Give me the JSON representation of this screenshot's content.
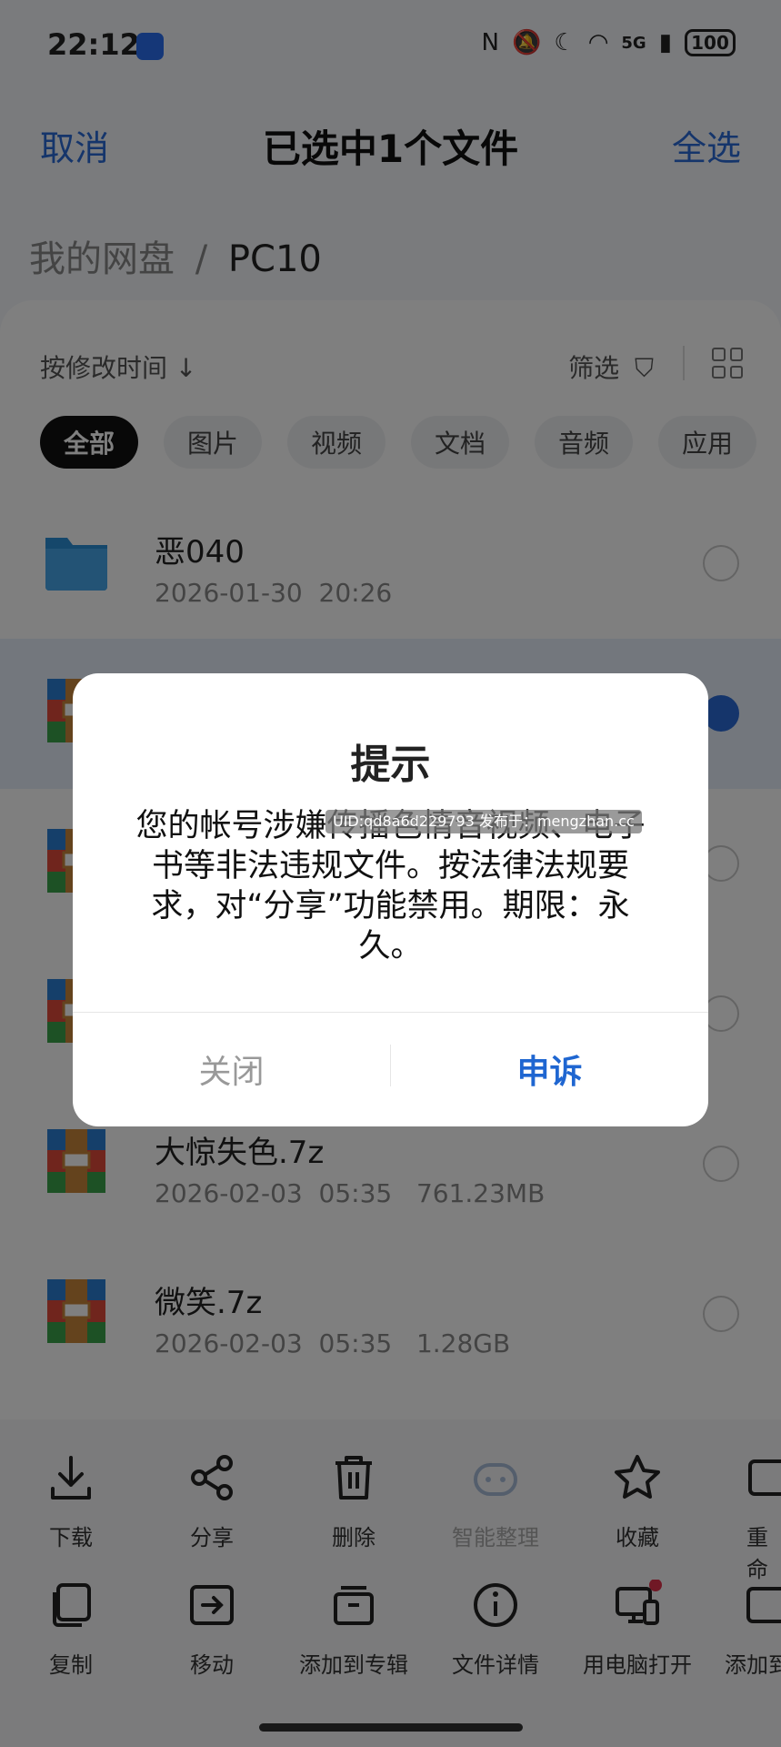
{
  "status_bar": {
    "time": "22:12",
    "network": "5G",
    "battery": "100"
  },
  "header": {
    "cancel": "取消",
    "title": "已选中1个文件",
    "select_all": "全选"
  },
  "breadcrumb": {
    "root": "我的网盘",
    "separator": "/",
    "current": "PC10"
  },
  "toolbar": {
    "sort": "按修改时间",
    "filter": "筛选"
  },
  "chips": [
    "全部",
    "图片",
    "视频",
    "文档",
    "音频",
    "应用"
  ],
  "files": [
    {
      "name": "恶040",
      "date": "2026-01-30",
      "time": "20:26",
      "size": "",
      "type": "folder",
      "selected": false
    },
    {
      "name": "",
      "date": "",
      "time": "",
      "size": "",
      "type": "archive",
      "selected": true
    },
    {
      "name": "",
      "date": "",
      "time": "",
      "size": "",
      "type": "archive",
      "selected": false
    },
    {
      "name": "",
      "date": "",
      "time": "",
      "size": "",
      "type": "archive",
      "selected": false
    },
    {
      "name": "大惊失色.7z",
      "date": "2026-02-03",
      "time": "05:35",
      "size": "761.23MB",
      "type": "archive",
      "selected": false
    },
    {
      "name": "微笑.7z",
      "date": "2026-02-03",
      "time": "05:35",
      "size": "1.28GB",
      "type": "archive",
      "selected": false
    }
  ],
  "actions_row1": [
    {
      "label": "下载",
      "icon": "download-icon",
      "enabled": true
    },
    {
      "label": "分享",
      "icon": "share-icon",
      "enabled": true
    },
    {
      "label": "删除",
      "icon": "trash-icon",
      "enabled": true
    },
    {
      "label": "智能整理",
      "icon": "ai-organize-icon",
      "enabled": false
    },
    {
      "label": "收藏",
      "icon": "star-icon",
      "enabled": true
    },
    {
      "label": "重命",
      "icon": "rename-icon",
      "enabled": true
    }
  ],
  "actions_row2": [
    {
      "label": "复制",
      "icon": "copy-icon",
      "enabled": true
    },
    {
      "label": "移动",
      "icon": "move-icon",
      "enabled": true
    },
    {
      "label": "添加到专辑",
      "icon": "album-icon",
      "enabled": true
    },
    {
      "label": "文件详情",
      "icon": "info-icon",
      "enabled": true
    },
    {
      "label": "用电脑打开",
      "icon": "computer-icon",
      "enabled": true
    },
    {
      "label": "添加到",
      "icon": "add-to-icon",
      "enabled": true
    }
  ],
  "dialog": {
    "title": "提示",
    "message": "您的帐号涉嫌传播色情音视频、电子书等非法违规文件。按法律法规要求，对“分享”功能禁用。期限：永久。",
    "close": "关闭",
    "appeal": "申诉",
    "watermark": "UID:qd8a6d229793 发布于：mengzhan.cc"
  },
  "colors": {
    "accent": "#2a6ad6",
    "selected_row": "#e7eefb",
    "overlay": "rgba(0,0,0,0.5)"
  }
}
